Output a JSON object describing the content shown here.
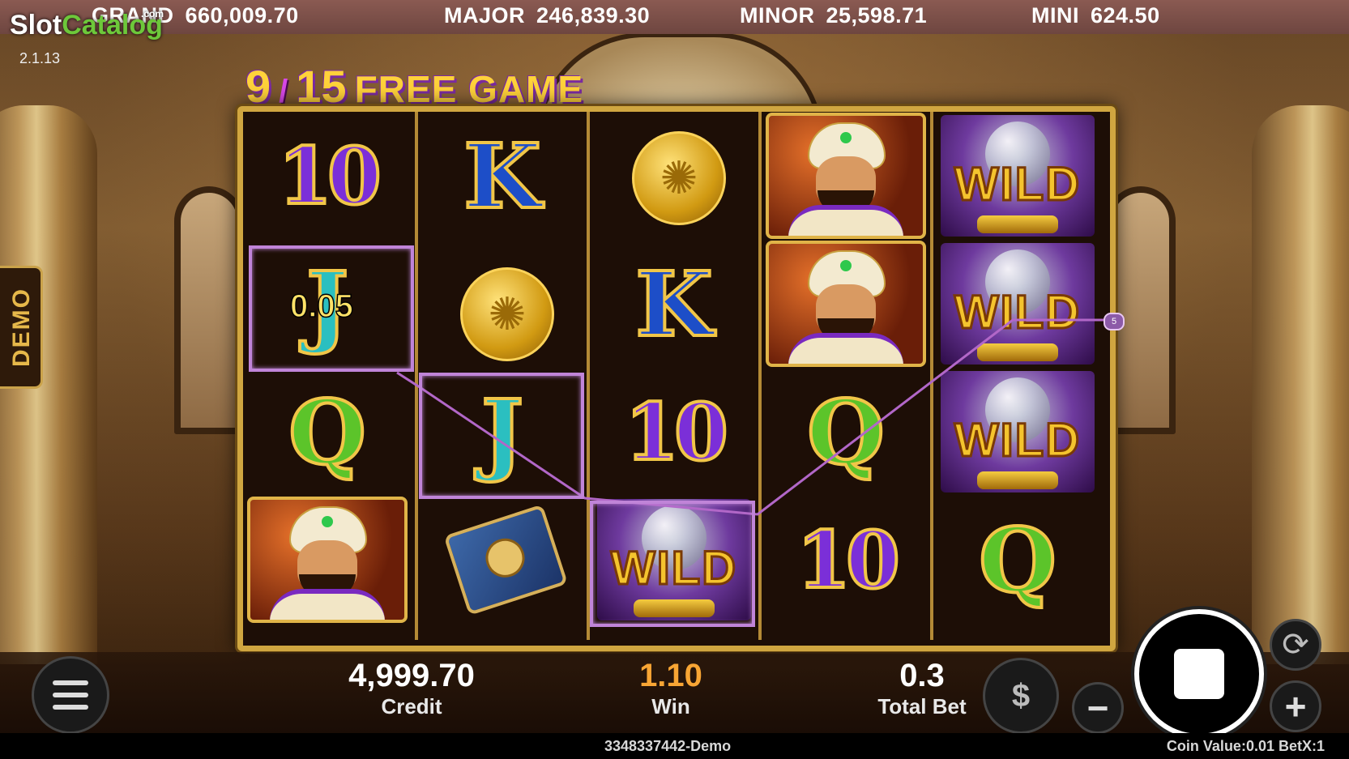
{
  "branding": {
    "logo_slot": "Slot",
    "logo_catalog": "Catalog",
    "logo_com": ".com",
    "version": "2.1.13"
  },
  "jackpots": [
    {
      "label": "GRAND",
      "value": "660,009.70"
    },
    {
      "label": "MAJOR",
      "value": "246,839.30"
    },
    {
      "label": "MINOR",
      "value": "25,598.71"
    },
    {
      "label": "MINI",
      "value": "624.50"
    }
  ],
  "demo_tab": "DEMO",
  "free_game": {
    "current": "9",
    "separator": "/",
    "total": "15",
    "label": "FREE GAME"
  },
  "reels": [
    [
      "10",
      "J",
      "Q",
      "SULTAN"
    ],
    [
      "K",
      "COINS",
      "J",
      "BOOK"
    ],
    [
      "COINS",
      "K",
      "10",
      "WILD"
    ],
    [
      "SULTAN",
      "SULTAN",
      "Q",
      "10"
    ],
    [
      "WILD",
      "WILD",
      "WILD",
      "Q"
    ]
  ],
  "symbol_text": {
    "ten": "10",
    "k": "K",
    "q": "Q",
    "j": "J",
    "wild": "WILD"
  },
  "win_display": {
    "amount": "0.05",
    "line_number": "5"
  },
  "bottom_bar": {
    "credit_value": "4,999.70",
    "credit_label": "Credit",
    "win_value": "1.10",
    "win_label": "Win",
    "total_bet_value": "0.3",
    "total_bet_label": "Total Bet",
    "coin_icon_glyph": "$",
    "minus_glyph": "−",
    "plus_glyph": "+",
    "autoplay_glyph": "⟳"
  },
  "footer": {
    "round_id": "3348337442-Demo",
    "coin_value": "Coin Value:0.01 BetX:1"
  },
  "colors": {
    "accent_gold": "#d0a640",
    "win_highlight": "#c084d8",
    "win_value": "#f7a534"
  }
}
